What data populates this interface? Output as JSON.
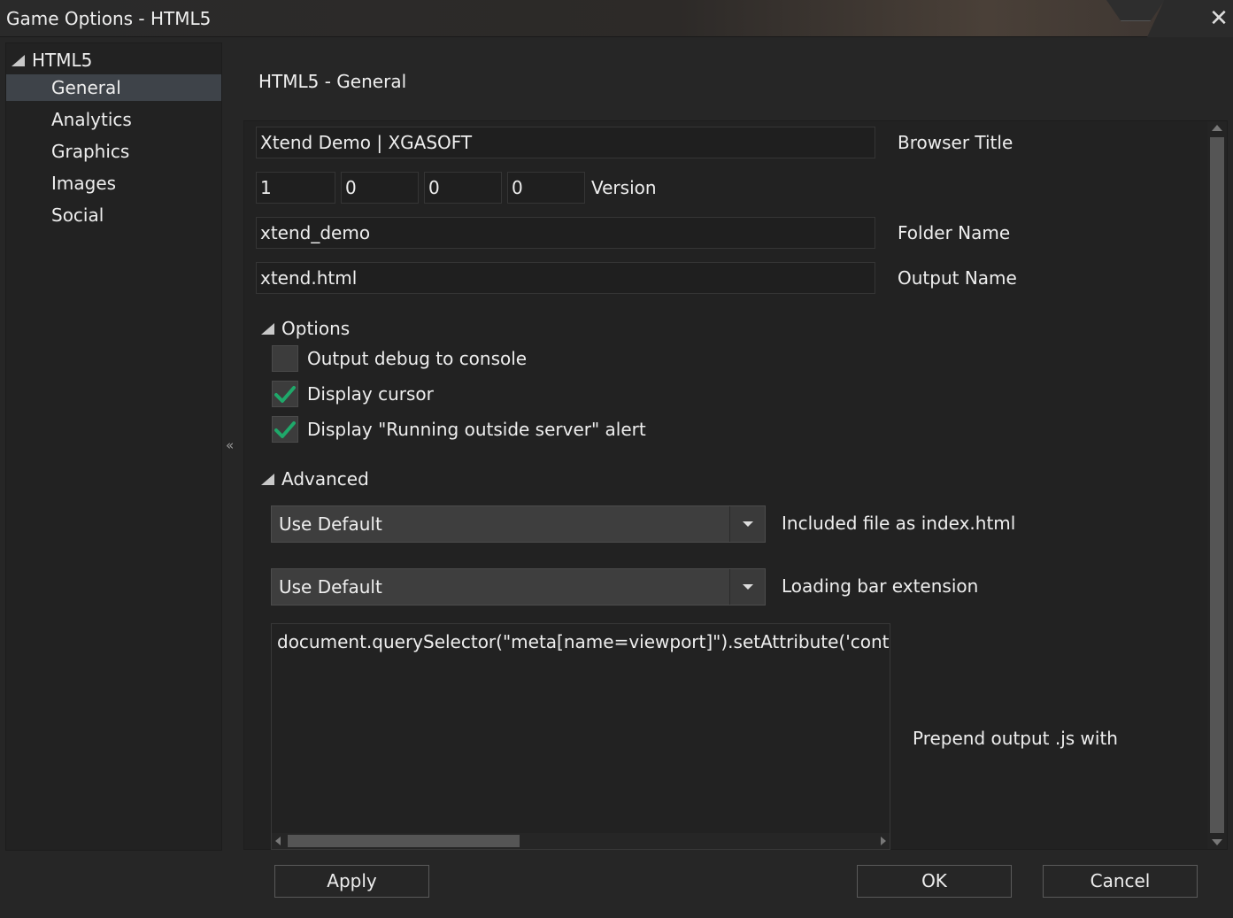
{
  "window": {
    "title": "Game Options - HTML5",
    "close_glyph": "✕"
  },
  "sidebar": {
    "root": "HTML5",
    "items": [
      {
        "label": "General",
        "selected": true
      },
      {
        "label": "Analytics"
      },
      {
        "label": "Graphics"
      },
      {
        "label": "Images"
      },
      {
        "label": "Social"
      }
    ]
  },
  "collapse_glyph": "«",
  "main": {
    "page_title": "HTML5 - General",
    "browser_title": {
      "value": "Xtend Demo | XGASOFT",
      "label": "Browser Title"
    },
    "version": {
      "parts": [
        "1",
        "0",
        "0",
        "0"
      ],
      "label": "Version"
    },
    "folder_name": {
      "value": "xtend_demo",
      "label": "Folder Name"
    },
    "output_name": {
      "value": "xtend.html",
      "label": "Output Name"
    },
    "options": {
      "header": "Options",
      "items": [
        {
          "label": "Output debug to console",
          "checked": false
        },
        {
          "label": "Display cursor",
          "checked": true
        },
        {
          "label": "Display \"Running outside server\" alert",
          "checked": true
        }
      ]
    },
    "advanced": {
      "header": "Advanced",
      "index_html": {
        "value": "Use Default",
        "label": "Included file as index.html"
      },
      "loading_bar": {
        "value": "Use Default",
        "label": "Loading bar extension"
      },
      "prepend_js": {
        "value": "document.querySelector(\"meta[name=viewport]\").setAttribute('conter",
        "label": "Prepend output .js with"
      }
    }
  },
  "footer": {
    "apply": "Apply",
    "ok": "OK",
    "cancel": "Cancel"
  },
  "colors": {
    "checkmark": "#1fa86a",
    "selected_row": "#3e4349"
  }
}
